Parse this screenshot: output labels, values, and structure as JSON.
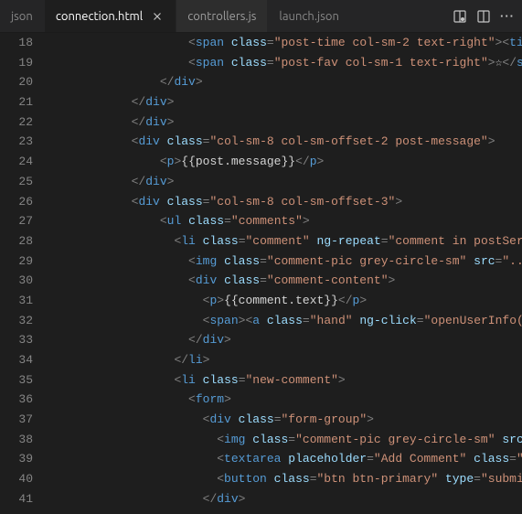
{
  "tabs": [
    {
      "label": "json",
      "active": false,
      "dim": true
    },
    {
      "label": "connection.html",
      "active": true,
      "closeable": true
    },
    {
      "label": "controllers.js",
      "active": false
    },
    {
      "label": "launch.json",
      "active": false,
      "dim": true
    }
  ],
  "action_icons": {
    "preview": "preview-icon",
    "split": "split-editor-icon",
    "more": "···"
  },
  "line_start": 18,
  "lines": [
    {
      "n": 18,
      "indent": 10,
      "tokens": [
        {
          "t": "pn",
          "v": "<"
        },
        {
          "t": "tg",
          "v": "span"
        },
        {
          "t": "tx",
          "v": " "
        },
        {
          "t": "at",
          "v": "class"
        },
        {
          "t": "pn",
          "v": "="
        },
        {
          "t": "st",
          "v": "\"post-time col-sm-2 text-right\""
        },
        {
          "t": "pn",
          "v": "><"
        },
        {
          "t": "tg",
          "v": "ti"
        }
      ]
    },
    {
      "n": 19,
      "indent": 10,
      "tokens": [
        {
          "t": "pn",
          "v": "<"
        },
        {
          "t": "tg",
          "v": "span"
        },
        {
          "t": "tx",
          "v": " "
        },
        {
          "t": "at",
          "v": "class"
        },
        {
          "t": "pn",
          "v": "="
        },
        {
          "t": "st",
          "v": "\"post-fav col-sm-1 text-right\""
        },
        {
          "t": "pn",
          "v": ">"
        },
        {
          "t": "tx",
          "v": "☆"
        },
        {
          "t": "pn",
          "v": "</"
        },
        {
          "t": "tg",
          "v": "s"
        }
      ]
    },
    {
      "n": 20,
      "indent": 8,
      "tokens": [
        {
          "t": "pn",
          "v": "</"
        },
        {
          "t": "tg",
          "v": "div"
        },
        {
          "t": "pn",
          "v": ">"
        }
      ]
    },
    {
      "n": 21,
      "indent": 6,
      "tokens": [
        {
          "t": "pn",
          "v": "</"
        },
        {
          "t": "tg",
          "v": "div"
        },
        {
          "t": "pn",
          "v": ">"
        }
      ]
    },
    {
      "n": 22,
      "indent": 6,
      "tokens": [
        {
          "t": "pn",
          "v": "</"
        },
        {
          "t": "tg",
          "v": "div"
        },
        {
          "t": "pn",
          "v": ">"
        }
      ]
    },
    {
      "n": 23,
      "indent": 6,
      "tokens": [
        {
          "t": "pn",
          "v": "<"
        },
        {
          "t": "tg",
          "v": "div"
        },
        {
          "t": "tx",
          "v": " "
        },
        {
          "t": "at",
          "v": "class"
        },
        {
          "t": "pn",
          "v": "="
        },
        {
          "t": "st",
          "v": "\"col-sm-8 col-sm-offset-2 post-message\""
        },
        {
          "t": "pn",
          "v": ">"
        }
      ]
    },
    {
      "n": 24,
      "indent": 8,
      "tokens": [
        {
          "t": "pn",
          "v": "<"
        },
        {
          "t": "tg",
          "v": "p"
        },
        {
          "t": "pn",
          "v": ">"
        },
        {
          "t": "tx",
          "v": "{{post.message}}"
        },
        {
          "t": "pn",
          "v": "</"
        },
        {
          "t": "tg",
          "v": "p"
        },
        {
          "t": "pn",
          "v": ">"
        }
      ]
    },
    {
      "n": 25,
      "indent": 6,
      "tokens": [
        {
          "t": "pn",
          "v": "</"
        },
        {
          "t": "tg",
          "v": "div"
        },
        {
          "t": "pn",
          "v": ">"
        }
      ]
    },
    {
      "n": 26,
      "indent": 6,
      "tokens": [
        {
          "t": "pn",
          "v": "<"
        },
        {
          "t": "tg",
          "v": "div"
        },
        {
          "t": "tx",
          "v": " "
        },
        {
          "t": "at",
          "v": "class"
        },
        {
          "t": "pn",
          "v": "="
        },
        {
          "t": "st",
          "v": "\"col-sm-8 col-sm-offset-3\""
        },
        {
          "t": "pn",
          "v": ">"
        }
      ]
    },
    {
      "n": 27,
      "indent": 8,
      "tokens": [
        {
          "t": "pn",
          "v": "<"
        },
        {
          "t": "tg",
          "v": "ul"
        },
        {
          "t": "tx",
          "v": " "
        },
        {
          "t": "at",
          "v": "class"
        },
        {
          "t": "pn",
          "v": "="
        },
        {
          "t": "st",
          "v": "\"comments\""
        },
        {
          "t": "pn",
          "v": ">"
        }
      ]
    },
    {
      "n": 28,
      "indent": 9,
      "tokens": [
        {
          "t": "pn",
          "v": "<"
        },
        {
          "t": "tg",
          "v": "li"
        },
        {
          "t": "tx",
          "v": " "
        },
        {
          "t": "at",
          "v": "class"
        },
        {
          "t": "pn",
          "v": "="
        },
        {
          "t": "st",
          "v": "\"comment\""
        },
        {
          "t": "tx",
          "v": " "
        },
        {
          "t": "at",
          "v": "ng-repeat"
        },
        {
          "t": "pn",
          "v": "="
        },
        {
          "t": "st",
          "v": "\"comment in postSer"
        }
      ]
    },
    {
      "n": 29,
      "indent": 10,
      "tokens": [
        {
          "t": "pn",
          "v": "<"
        },
        {
          "t": "tg",
          "v": "img"
        },
        {
          "t": "tx",
          "v": " "
        },
        {
          "t": "at",
          "v": "class"
        },
        {
          "t": "pn",
          "v": "="
        },
        {
          "t": "st",
          "v": "\"comment-pic grey-circle-sm\""
        },
        {
          "t": "tx",
          "v": " "
        },
        {
          "t": "at",
          "v": "src"
        },
        {
          "t": "pn",
          "v": "="
        },
        {
          "t": "st",
          "v": "\"..."
        }
      ]
    },
    {
      "n": 30,
      "indent": 10,
      "tokens": [
        {
          "t": "pn",
          "v": "<"
        },
        {
          "t": "tg",
          "v": "div"
        },
        {
          "t": "tx",
          "v": " "
        },
        {
          "t": "at",
          "v": "class"
        },
        {
          "t": "pn",
          "v": "="
        },
        {
          "t": "st",
          "v": "\"comment-content\""
        },
        {
          "t": "pn",
          "v": ">"
        }
      ]
    },
    {
      "n": 31,
      "indent": 11,
      "tokens": [
        {
          "t": "pn",
          "v": "<"
        },
        {
          "t": "tg",
          "v": "p"
        },
        {
          "t": "pn",
          "v": ">"
        },
        {
          "t": "tx",
          "v": "{{comment.text}}"
        },
        {
          "t": "pn",
          "v": "</"
        },
        {
          "t": "tg",
          "v": "p"
        },
        {
          "t": "pn",
          "v": ">"
        }
      ]
    },
    {
      "n": 32,
      "indent": 11,
      "tokens": [
        {
          "t": "pn",
          "v": "<"
        },
        {
          "t": "tg",
          "v": "span"
        },
        {
          "t": "pn",
          "v": "><"
        },
        {
          "t": "tg",
          "v": "a"
        },
        {
          "t": "tx",
          "v": " "
        },
        {
          "t": "at",
          "v": "class"
        },
        {
          "t": "pn",
          "v": "="
        },
        {
          "t": "st",
          "v": "\"hand\""
        },
        {
          "t": "tx",
          "v": " "
        },
        {
          "t": "at",
          "v": "ng-click"
        },
        {
          "t": "pn",
          "v": "="
        },
        {
          "t": "st",
          "v": "\"openUserInfo("
        }
      ]
    },
    {
      "n": 33,
      "indent": 10,
      "tokens": [
        {
          "t": "pn",
          "v": "</"
        },
        {
          "t": "tg",
          "v": "div"
        },
        {
          "t": "pn",
          "v": ">"
        }
      ]
    },
    {
      "n": 34,
      "indent": 9,
      "tokens": [
        {
          "t": "pn",
          "v": "</"
        },
        {
          "t": "tg",
          "v": "li"
        },
        {
          "t": "pn",
          "v": ">"
        }
      ]
    },
    {
      "n": 35,
      "indent": 9,
      "tokens": [
        {
          "t": "pn",
          "v": "<"
        },
        {
          "t": "tg",
          "v": "li"
        },
        {
          "t": "tx",
          "v": " "
        },
        {
          "t": "at",
          "v": "class"
        },
        {
          "t": "pn",
          "v": "="
        },
        {
          "t": "st",
          "v": "\"new-comment\""
        },
        {
          "t": "pn",
          "v": ">"
        }
      ]
    },
    {
      "n": 36,
      "indent": 10,
      "tokens": [
        {
          "t": "pn",
          "v": "<"
        },
        {
          "t": "tg",
          "v": "form"
        },
        {
          "t": "pn",
          "v": ">"
        }
      ]
    },
    {
      "n": 37,
      "indent": 11,
      "tokens": [
        {
          "t": "pn",
          "v": "<"
        },
        {
          "t": "tg",
          "v": "div"
        },
        {
          "t": "tx",
          "v": " "
        },
        {
          "t": "at",
          "v": "class"
        },
        {
          "t": "pn",
          "v": "="
        },
        {
          "t": "st",
          "v": "\"form-group\""
        },
        {
          "t": "pn",
          "v": ">"
        }
      ]
    },
    {
      "n": 38,
      "indent": 12,
      "tokens": [
        {
          "t": "pn",
          "v": "<"
        },
        {
          "t": "tg",
          "v": "img"
        },
        {
          "t": "tx",
          "v": " "
        },
        {
          "t": "at",
          "v": "class"
        },
        {
          "t": "pn",
          "v": "="
        },
        {
          "t": "st",
          "v": "\"comment-pic grey-circle-sm\""
        },
        {
          "t": "tx",
          "v": " "
        },
        {
          "t": "at",
          "v": "src"
        }
      ]
    },
    {
      "n": 39,
      "indent": 12,
      "tokens": [
        {
          "t": "pn",
          "v": "<"
        },
        {
          "t": "tg",
          "v": "textarea"
        },
        {
          "t": "tx",
          "v": " "
        },
        {
          "t": "at",
          "v": "placeholder"
        },
        {
          "t": "pn",
          "v": "="
        },
        {
          "t": "st",
          "v": "\"Add Comment\""
        },
        {
          "t": "tx",
          "v": " "
        },
        {
          "t": "at",
          "v": "class"
        },
        {
          "t": "pn",
          "v": "="
        },
        {
          "t": "st",
          "v": "\""
        }
      ]
    },
    {
      "n": 40,
      "indent": 12,
      "tokens": [
        {
          "t": "pn",
          "v": "<"
        },
        {
          "t": "tg",
          "v": "button"
        },
        {
          "t": "tx",
          "v": " "
        },
        {
          "t": "at",
          "v": "class"
        },
        {
          "t": "pn",
          "v": "="
        },
        {
          "t": "st",
          "v": "\"btn btn-primary\""
        },
        {
          "t": "tx",
          "v": " "
        },
        {
          "t": "at",
          "v": "type"
        },
        {
          "t": "pn",
          "v": "="
        },
        {
          "t": "st",
          "v": "\"submi"
        }
      ]
    },
    {
      "n": 41,
      "indent": 11,
      "tokens": [
        {
          "t": "pn",
          "v": "</"
        },
        {
          "t": "tg",
          "v": "div"
        },
        {
          "t": "pn",
          "v": ">"
        }
      ]
    }
  ]
}
